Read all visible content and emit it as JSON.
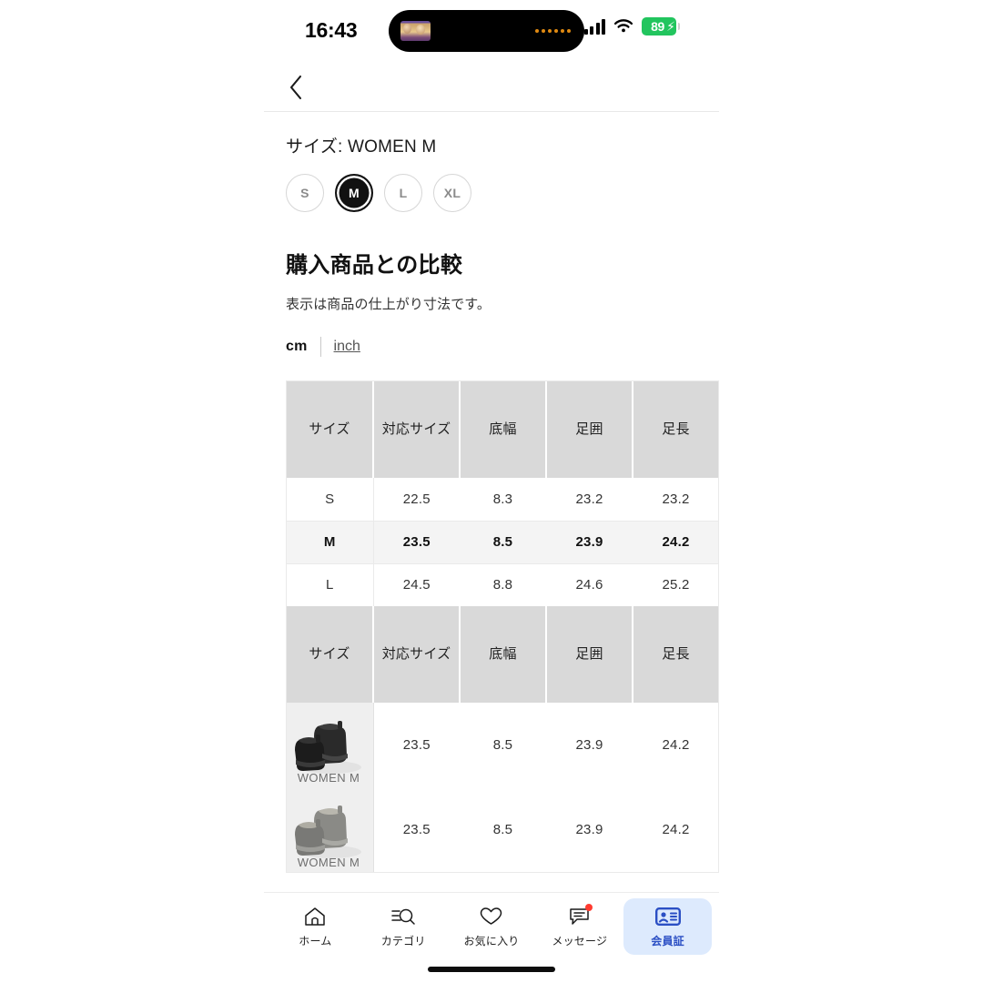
{
  "status_bar": {
    "time": "16:43",
    "battery_percent": "89",
    "battery_charging_icon": "bolt-icon",
    "signal_icon": "cellular-signal-icon",
    "wifi_icon": "wifi-icon",
    "dynamic_island_icon": "dynamic-island-media-pill"
  },
  "app_bar": {
    "back_icon": "chevron-left-icon"
  },
  "size_selector": {
    "label": "サイズ: WOMEN M",
    "selected": "M",
    "options": [
      "S",
      "M",
      "L",
      "XL"
    ]
  },
  "comparison": {
    "title": "購入商品との比較",
    "note": "表示は商品の仕上がり寸法です。",
    "unit_active": "cm",
    "unit_inactive": "inch"
  },
  "size_table": {
    "headers": [
      "サイズ",
      "対応サイズ",
      "底幅",
      "足囲",
      "足長",
      ""
    ],
    "rows": [
      {
        "size": "S",
        "values": [
          "22.5",
          "8.3",
          "23.2",
          "23.2",
          ""
        ],
        "highlight": false
      },
      {
        "size": "M",
        "values": [
          "23.5",
          "8.5",
          "23.9",
          "24.2",
          ""
        ],
        "highlight": true
      },
      {
        "size": "L",
        "values": [
          "24.5",
          "8.8",
          "24.6",
          "25.2",
          ""
        ],
        "highlight": false
      }
    ]
  },
  "product_table": {
    "headers": [
      "サイズ",
      "対応サイズ",
      "底幅",
      "足囲",
      "足長",
      ""
    ],
    "rows": [
      {
        "caption": "WOMEN M",
        "color": "black",
        "values": [
          "23.5",
          "8.5",
          "23.9",
          "24.2",
          ""
        ]
      },
      {
        "caption": "WOMEN M",
        "color": "gray",
        "values": [
          "23.5",
          "8.5",
          "23.9",
          "24.2",
          ""
        ]
      }
    ]
  },
  "tab_bar": {
    "items": [
      {
        "label": "ホーム",
        "icon": "home-icon",
        "active": false,
        "badge": false
      },
      {
        "label": "カテゴリ",
        "icon": "category-search-icon",
        "active": false,
        "badge": false
      },
      {
        "label": "お気に入り",
        "icon": "heart-icon",
        "active": false,
        "badge": false
      },
      {
        "label": "メッセージ",
        "icon": "chat-bubble-icon",
        "active": false,
        "badge": true
      },
      {
        "label": "会員証",
        "icon": "membership-card-icon",
        "active": true,
        "badge": false
      }
    ],
    "active_bg_color": "#ddeafd",
    "active_fg_color": "#2b4fc4",
    "badge_color": "#ff3b30"
  }
}
